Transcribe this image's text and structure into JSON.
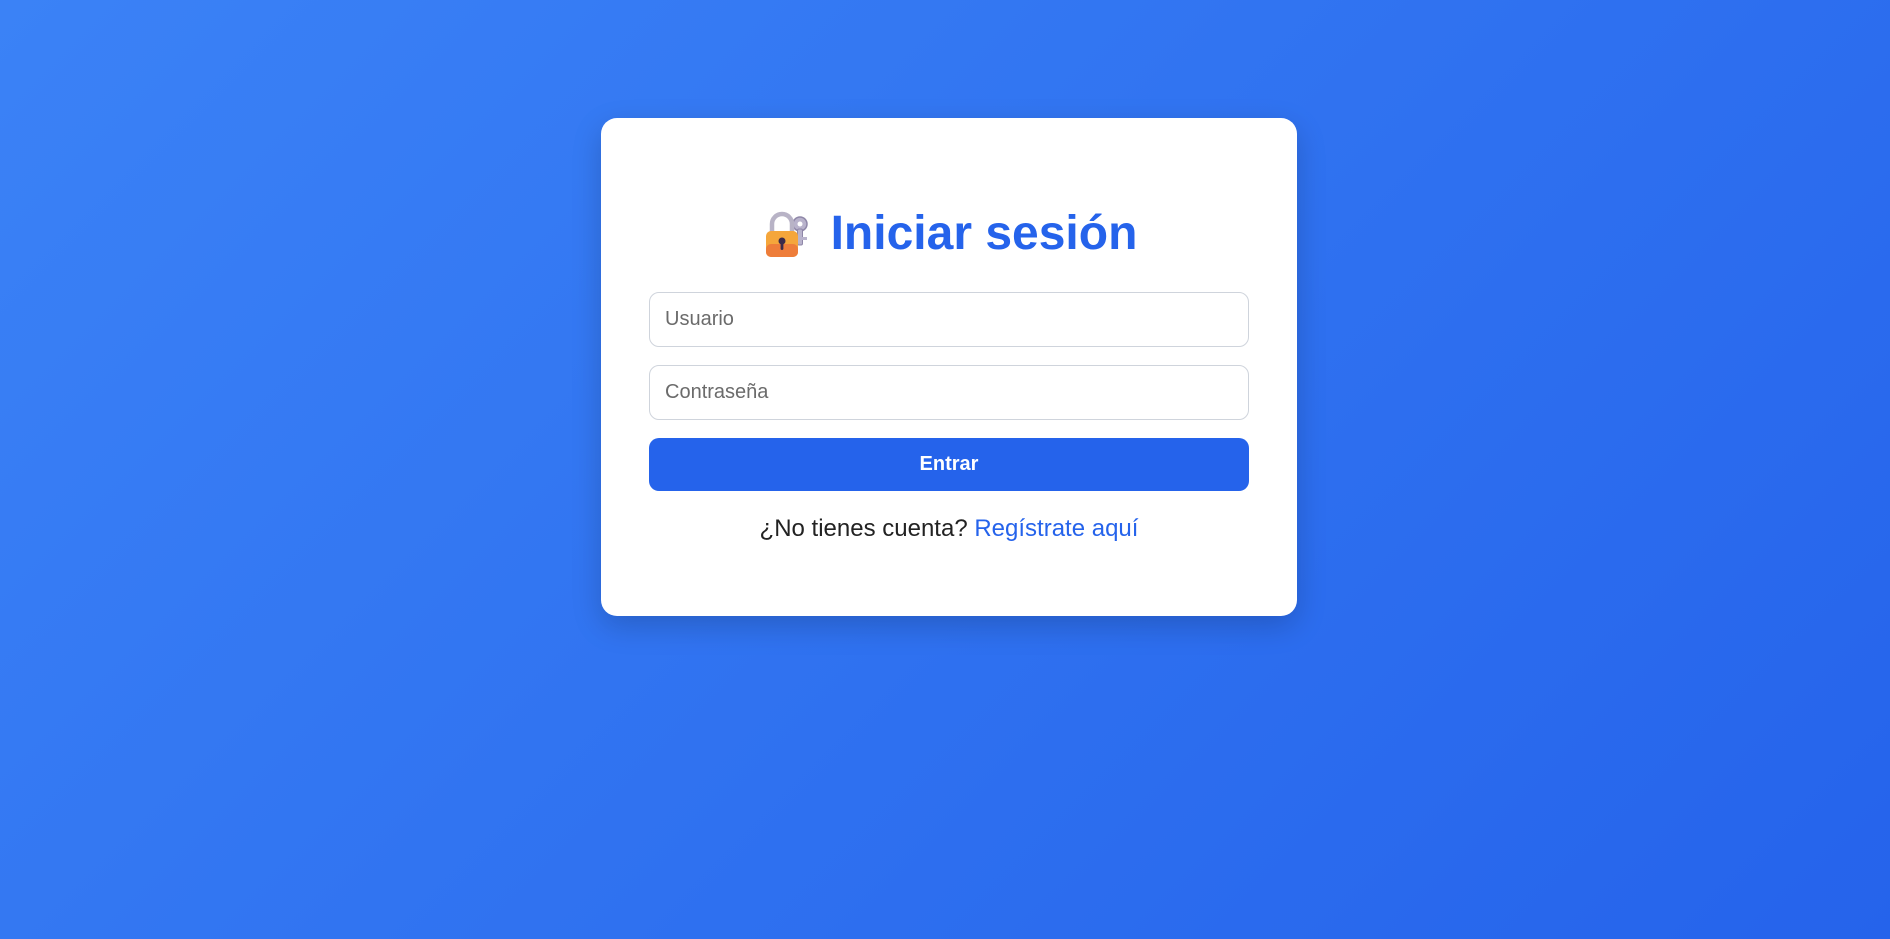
{
  "login": {
    "icon": "lock-with-key-icon",
    "title": "Iniciar sesión",
    "username_placeholder": "Usuario",
    "username_value": "",
    "password_placeholder": "Contraseña",
    "password_value": "",
    "submit_label": "Entrar",
    "signup_prompt": "¿No tienes cuenta?",
    "signup_link": "Regístrate aquí"
  },
  "colors": {
    "background_start": "#3b82f6",
    "background_end": "#2563eb",
    "accent": "#2563eb",
    "card": "#ffffff"
  }
}
